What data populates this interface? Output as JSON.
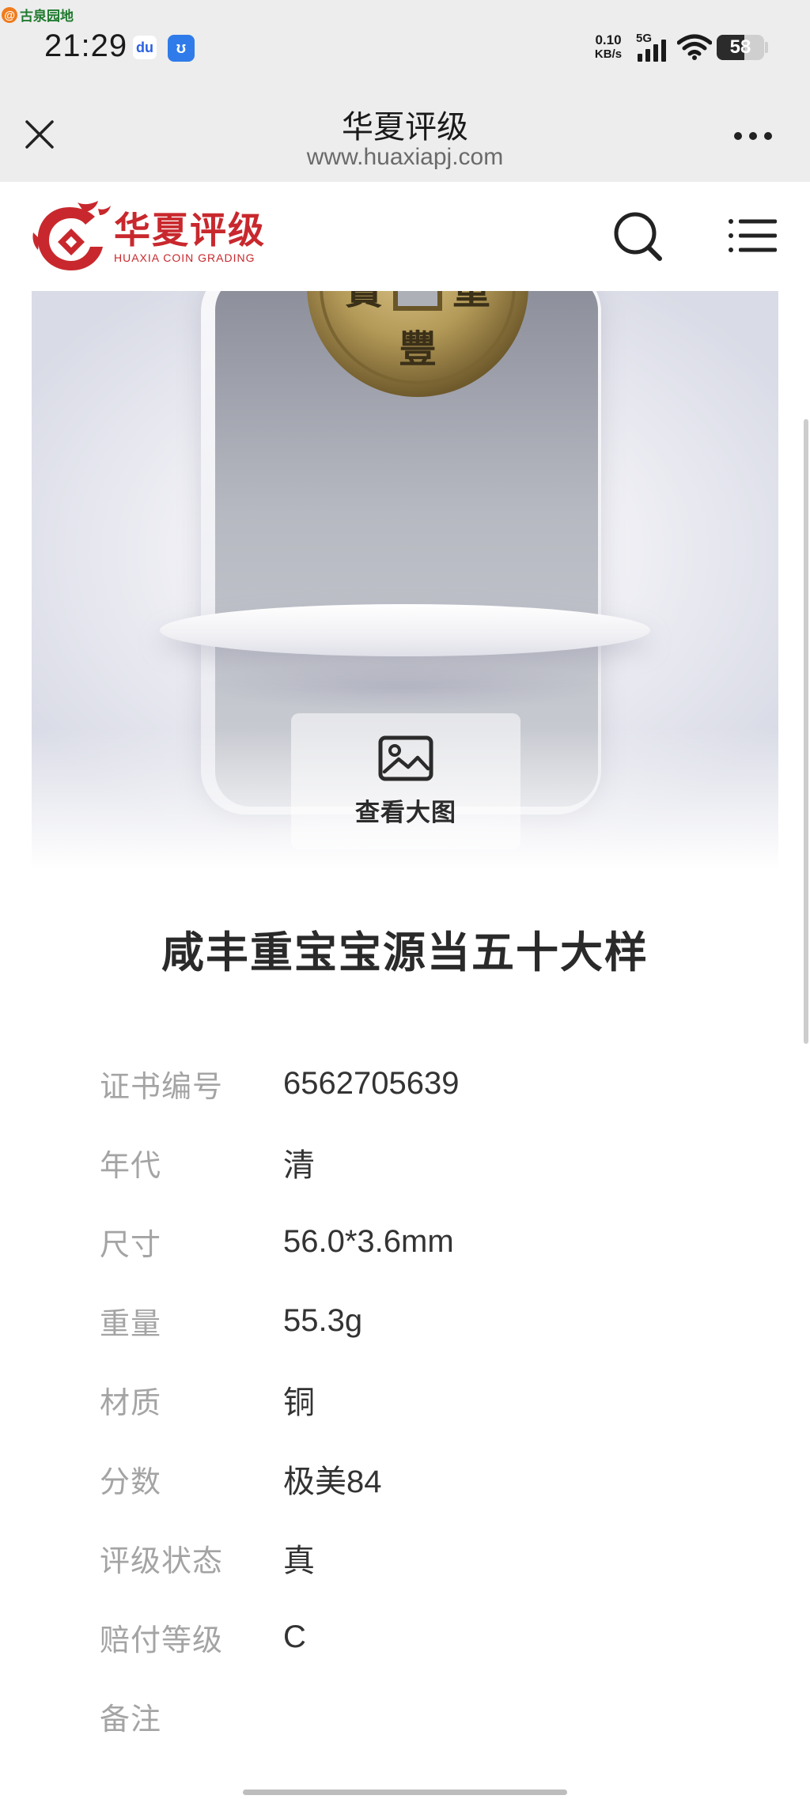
{
  "status_bar": {
    "watermark": "古泉园地",
    "time": "21:29",
    "net_speed_value": "0.10",
    "net_speed_unit": "KB/s",
    "network": "5G",
    "battery": "58",
    "battery_level_percent": 58,
    "notification_icons": [
      "baidu-paw-icon",
      "blue-app-icon"
    ]
  },
  "browser": {
    "title": "华夏评级",
    "url": "www.huaxiapj.com",
    "close_icon": "close-icon",
    "more_icon": "more-dots-icon"
  },
  "site_header": {
    "logo_cn": "华夏评级",
    "logo_en": "HUAXIA COIN GRADING",
    "search_icon": "search-icon",
    "menu_icon": "menu-icon"
  },
  "product_image": {
    "view_large_label": "查看大图",
    "view_large_icon": "image-icon"
  },
  "product": {
    "title": "咸丰重宝宝源当五十大样",
    "fields": [
      {
        "label": "证书编号",
        "value": "6562705639"
      },
      {
        "label": "年代",
        "value": "清"
      },
      {
        "label": "尺寸",
        "value": "56.0*3.6mm"
      },
      {
        "label": "重量",
        "value": "55.3g"
      },
      {
        "label": "材质",
        "value": "铜"
      },
      {
        "label": "分数",
        "value": "极美84"
      },
      {
        "label": "评级状态",
        "value": "真"
      },
      {
        "label": "赔付等级",
        "value": "C"
      },
      {
        "label": "备注",
        "value": ""
      }
    ]
  },
  "colors": {
    "brand_red": "#c8282d",
    "label_gray": "#a4a4a4",
    "value_text": "#333333",
    "chrome_bg": "#ededed"
  }
}
